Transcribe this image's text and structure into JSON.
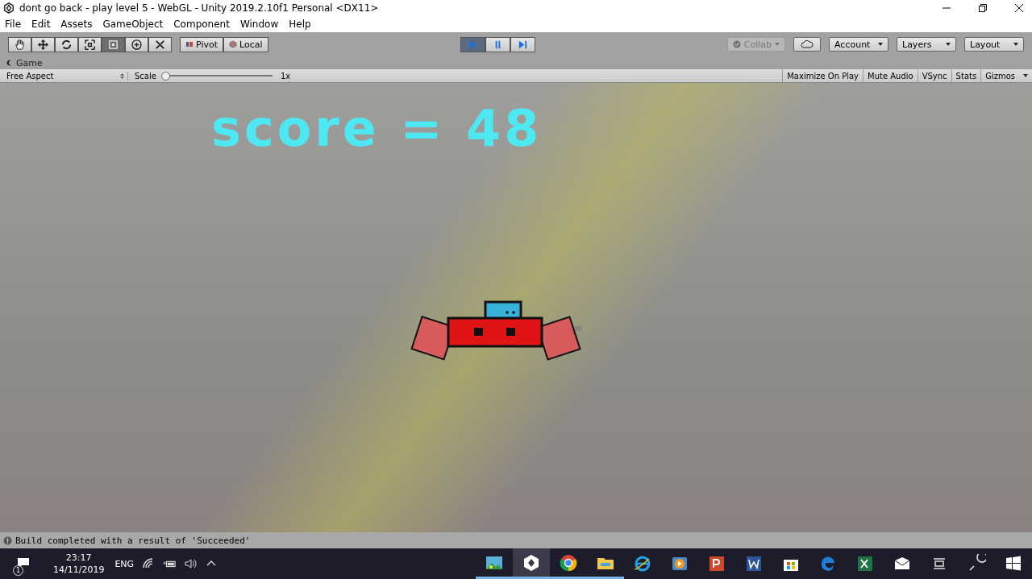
{
  "window": {
    "title": "dont go back - play level 5 - WebGL - Unity 2019.2.10f1 Personal <DX11>"
  },
  "menu": [
    "File",
    "Edit",
    "Assets",
    "GameObject",
    "Component",
    "Window",
    "Help"
  ],
  "tools": [
    {
      "kind": "hand",
      "selected": false
    },
    {
      "kind": "move",
      "selected": false
    },
    {
      "kind": "rotate",
      "selected": false
    },
    {
      "kind": "scale",
      "selected": false
    },
    {
      "kind": "rect",
      "selected": true
    },
    {
      "kind": "transform",
      "selected": false
    },
    {
      "kind": "custom",
      "selected": false
    }
  ],
  "handle_buttons": [
    {
      "kind": "pivot",
      "label": "Pivot"
    },
    {
      "kind": "local",
      "label": "Local"
    }
  ],
  "play_controls": [
    {
      "kind": "play",
      "selected": true
    },
    {
      "kind": "pause",
      "selected": false
    },
    {
      "kind": "step",
      "selected": false
    }
  ],
  "collab": {
    "label": "Collab",
    "disabled": true
  },
  "dropdowns": [
    "Account",
    "Layers",
    "Layout"
  ],
  "game_tab": {
    "label": "Game"
  },
  "game_toolbar": {
    "aspect": "Free Aspect",
    "scale_label": "Scale",
    "scale": {
      "level": 0.0,
      "reading": "1x"
    },
    "toggles": [
      "Maximize On Play",
      "Mute Audio",
      "VSync",
      "Stats",
      "Gizmos"
    ]
  },
  "game": {
    "score_text": "score = 48"
  },
  "status_bar": {
    "message": "Build completed with a result of 'Succeeded'"
  },
  "taskbar": {
    "notification_count": "1",
    "time": "23:17",
    "date": "14/11/2019",
    "language": "ENG",
    "apps": [
      {
        "kind": "photos",
        "running": true,
        "selected": false
      },
      {
        "kind": "unity",
        "running": true,
        "selected": true
      },
      {
        "kind": "chrome",
        "running": true,
        "selected": false
      },
      {
        "kind": "files",
        "running": true,
        "selected": false
      },
      {
        "kind": "ie",
        "running": false,
        "selected": false
      },
      {
        "kind": "media",
        "running": false,
        "selected": false
      },
      {
        "kind": "powerpoint",
        "running": false,
        "selected": false
      },
      {
        "kind": "word",
        "running": false,
        "selected": false
      },
      {
        "kind": "store",
        "running": false,
        "selected": false
      },
      {
        "kind": "edge",
        "running": false,
        "selected": false
      },
      {
        "kind": "excel",
        "running": false,
        "selected": false
      },
      {
        "kind": "mail",
        "running": false,
        "selected": false
      },
      {
        "kind": "taskview",
        "running": false,
        "selected": false
      },
      {
        "kind": "search",
        "running": false,
        "selected": false
      },
      {
        "kind": "start",
        "running": false,
        "selected": false
      }
    ]
  }
}
